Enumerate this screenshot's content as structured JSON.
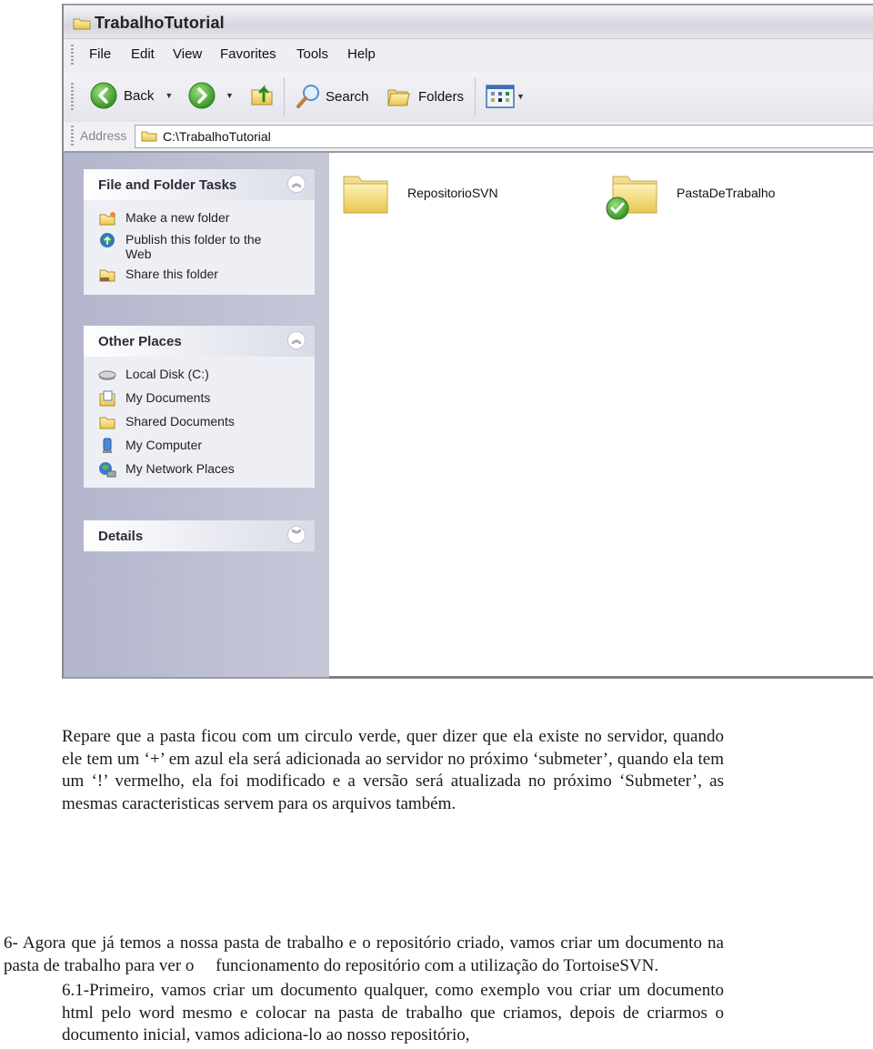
{
  "window": {
    "title": "TrabalhoTutorial",
    "menu": [
      "File",
      "Edit",
      "View",
      "Favorites",
      "Tools",
      "Help"
    ],
    "toolbar": {
      "back_label": "Back",
      "search_label": "Search",
      "folders_label": "Folders"
    },
    "address": {
      "label": "Address",
      "value": "C:\\TrabalhoTutorial"
    },
    "sidebar": {
      "panels": [
        {
          "title": "File and Folder Tasks",
          "state": "expanded",
          "items": [
            {
              "label": "Make a new folder",
              "icon": "new-folder-icon"
            },
            {
              "label": "Publish this folder to the Web",
              "icon": "publish-web-icon"
            },
            {
              "label": "Share this folder",
              "icon": "share-folder-icon"
            }
          ]
        },
        {
          "title": "Other Places",
          "state": "expanded",
          "items": [
            {
              "label": "Local Disk (C:)",
              "icon": "disk-icon"
            },
            {
              "label": "My Documents",
              "icon": "my-documents-icon"
            },
            {
              "label": "Shared Documents",
              "icon": "shared-documents-icon"
            },
            {
              "label": "My Computer",
              "icon": "my-computer-icon"
            },
            {
              "label": "My Network Places",
              "icon": "network-places-icon"
            }
          ]
        },
        {
          "title": "Details",
          "state": "collapsed",
          "items": []
        }
      ]
    },
    "files": [
      {
        "name": "RepositorioSVN",
        "overlay": "none"
      },
      {
        "name": "PastaDeTrabalho",
        "overlay": "svn-normal-green-check"
      }
    ]
  },
  "document": {
    "paragraph1": "Repare que a pasta ficou com um circulo verde, quer dizer que ela existe no servidor, quando ele tem um ‘+’ em azul ela será adicionada ao servidor no próximo ‘submeter’, quando ela tem um ‘!’ vermelho, ela foi modificado e a versão será atualizada no próximo ‘Submeter’, as mesmas caracteristicas servem para os arquivos também.",
    "paragraph2": "6- Agora que já temos a nossa pasta de trabalho e o repositório criado, vamos criar um documento na pasta de trabalho para ver o     funcionamento do repositório com a utilização do TortoiseSVN.",
    "paragraph3": "6.1-Primeiro, vamos criar um documento qualquer, como exemplo vou criar um documento html pelo word mesmo e colocar na pasta de trabalho que criamos, depois de criarmos o documento inicial, vamos adiciona-lo ao nosso repositório,"
  },
  "colors": {
    "sidebar_bg": "#b3b6cc",
    "folder_yellow": "#f5d76e",
    "check_green": "#3a9a2a"
  }
}
